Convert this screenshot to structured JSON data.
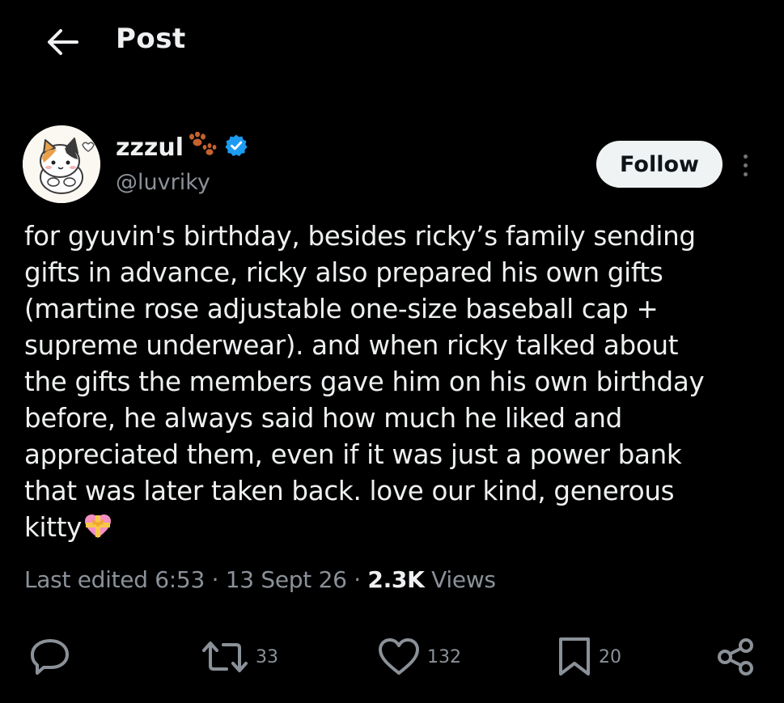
{
  "header": {
    "title": "Post",
    "back_icon": "arrow-left-icon"
  },
  "author": {
    "display_name": "zzzul",
    "handle": "@luvriky",
    "name_emoji": "paw-prints-icon",
    "verified": true,
    "verified_color": "#1d9bf0",
    "follow_label": "Follow"
  },
  "post": {
    "text": "for gyuvin's birthday, besides ricky’s family sending\ngifts in advance, ricky also prepared his own gifts\n(martine rose adjustable one-size baseball cap +\nsupreme underwear). and when ricky talked about\nthe gifts the members gave him on his own birthday\nbefore, he always said how much he liked and\nappreciated them, even if it was just a power bank\nthat was later taken back. love our kind, generous\nkitty",
    "trailing_emoji": "heart-with-ribbon-icon"
  },
  "meta": {
    "edited_label": "Last edited 6:53",
    "sep1": " · ",
    "date": "13 Sept 26",
    "sep2": " · ",
    "views_count": "2.3K",
    "views_label": " Views"
  },
  "actions": {
    "reply": {
      "icon": "reply-bubble-icon",
      "count": ""
    },
    "repost": {
      "icon": "repost-icon",
      "count": "33"
    },
    "like": {
      "icon": "heart-icon",
      "count": "132"
    },
    "bookmark": {
      "icon": "bookmark-icon",
      "count": "20"
    },
    "share": {
      "icon": "share-icon",
      "count": ""
    }
  },
  "colors": {
    "background": "#000000",
    "text": "#eef0f1",
    "muted": "#8b9198",
    "follow_bg": "#eff3f4"
  }
}
